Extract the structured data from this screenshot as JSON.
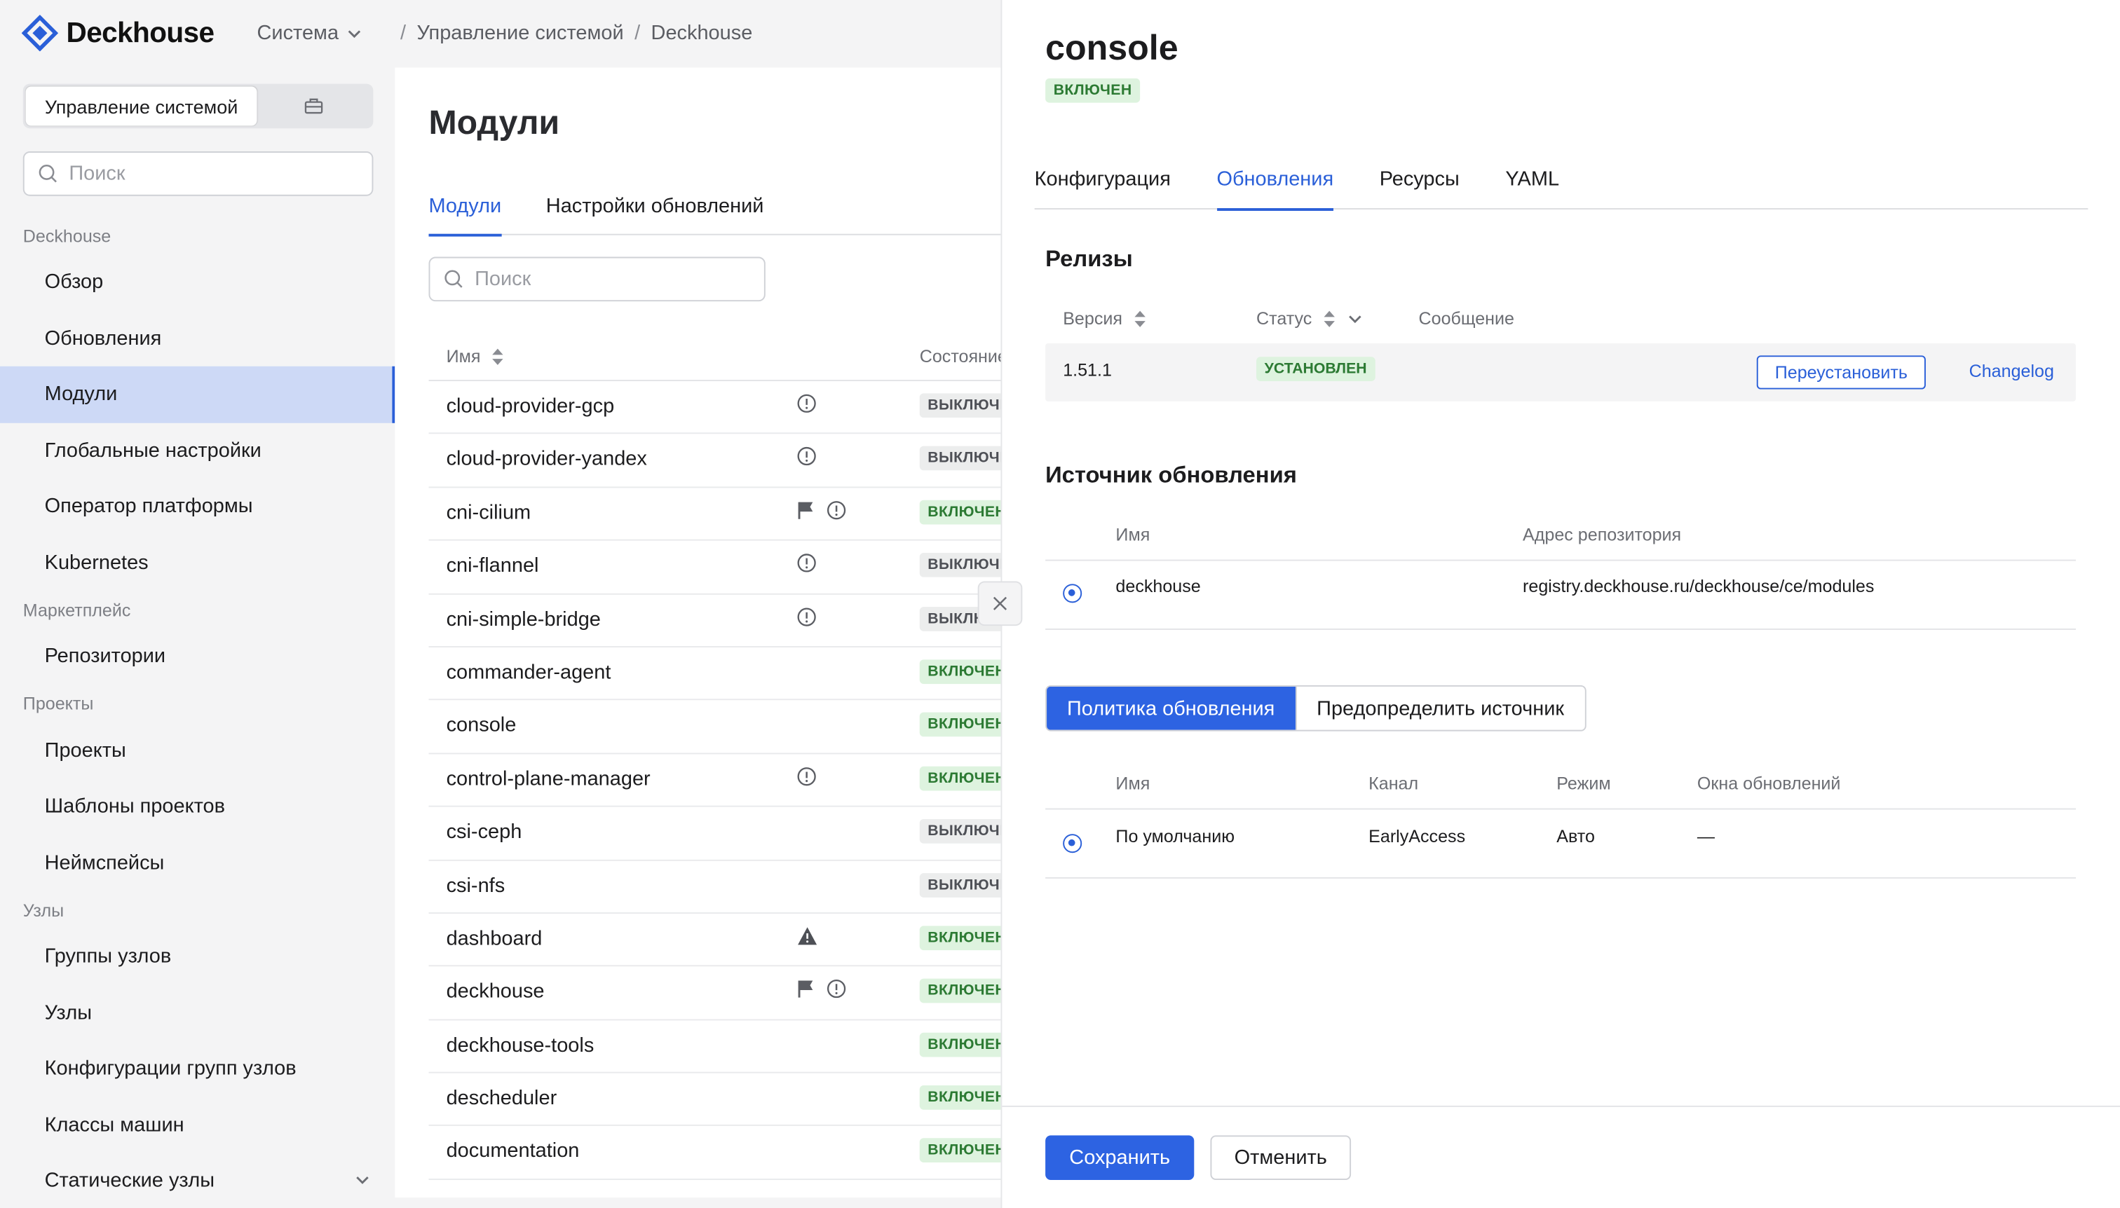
{
  "brand": {
    "name": "Deckhouse",
    "color": "#2a5fd8"
  },
  "header": {
    "system_menu": "Система",
    "breadcrumb": [
      "Управление системой",
      "Deckhouse"
    ],
    "separator": "/"
  },
  "sidebar": {
    "segment_label": "Управление системой",
    "search_placeholder": "Поиск",
    "groups": [
      {
        "label": "Deckhouse",
        "items": [
          "Обзор",
          "Обновления",
          "Модули",
          "Глобальные настройки",
          "Оператор платформы",
          "Kubernetes"
        ]
      },
      {
        "label": "Маркетплейс",
        "items": [
          "Репозитории"
        ]
      },
      {
        "label": "Проекты",
        "items": [
          "Проекты",
          "Шаблоны проектов",
          "Неймспейсы"
        ]
      },
      {
        "label": "Узлы",
        "items": [
          "Группы узлов",
          "Узлы",
          "Конфигурации групп узлов",
          "Классы машин",
          "Статические узлы"
        ]
      }
    ],
    "active_item": "Модули"
  },
  "modules": {
    "title": "Модули",
    "tabs": [
      "Модули",
      "Настройки обновлений"
    ],
    "search_placeholder": "Поиск",
    "columns": {
      "name": "Имя",
      "state": "Состояние"
    },
    "rows": [
      {
        "name": "cloud-provider-gcp",
        "icons": [
          "info-icon"
        ],
        "state": "ВЫКЛЮЧЕН",
        "on": false
      },
      {
        "name": "cloud-provider-yandex",
        "icons": [
          "info-icon"
        ],
        "state": "ВЫКЛЮЧЕН",
        "on": false
      },
      {
        "name": "cni-cilium",
        "icons": [
          "flag-icon",
          "info-icon"
        ],
        "state": "ВКЛЮЧЕН",
        "on": true
      },
      {
        "name": "cni-flannel",
        "icons": [
          "info-icon"
        ],
        "state": "ВЫКЛЮЧЕН",
        "on": false
      },
      {
        "name": "cni-simple-bridge",
        "icons": [
          "info-icon"
        ],
        "state": "ВЫКЛЮЧЕН",
        "on": false
      },
      {
        "name": "commander-agent",
        "icons": [],
        "state": "ВКЛЮЧЕН",
        "on": true
      },
      {
        "name": "console",
        "icons": [],
        "state": "ВКЛЮЧЕН",
        "on": true
      },
      {
        "name": "control-plane-manager",
        "icons": [
          "info-icon"
        ],
        "state": "ВКЛЮЧЕН",
        "on": true
      },
      {
        "name": "csi-ceph",
        "icons": [],
        "state": "ВЫКЛЮЧЕН",
        "on": false
      },
      {
        "name": "csi-nfs",
        "icons": [],
        "state": "ВЫКЛЮЧЕН",
        "on": false
      },
      {
        "name": "dashboard",
        "icons": [
          "warning-icon"
        ],
        "state": "ВКЛЮЧЕН",
        "on": true
      },
      {
        "name": "deckhouse",
        "icons": [
          "flag-icon",
          "info-icon"
        ],
        "state": "ВКЛЮЧЕН",
        "on": true
      },
      {
        "name": "deckhouse-tools",
        "icons": [],
        "state": "ВКЛЮЧЕН",
        "on": true
      },
      {
        "name": "descheduler",
        "icons": [],
        "state": "ВКЛЮЧЕН",
        "on": true
      },
      {
        "name": "documentation",
        "icons": [],
        "state": "ВКЛЮЧЕН",
        "on": true
      }
    ]
  },
  "panel": {
    "title": "console",
    "state": "ВКЛЮЧЕН",
    "tabs": [
      "Конфигурация",
      "Обновления",
      "Ресурсы",
      "YAML"
    ],
    "active_tab": "Обновления",
    "releases": {
      "title": "Релизы",
      "columns": {
        "version": "Версия",
        "status": "Статус",
        "message": "Сообщение"
      },
      "row": {
        "version": "1.51.1",
        "status": "УСТАНОВЛЕН",
        "reinstall": "Переустановить",
        "changelog": "Changelog"
      }
    },
    "source": {
      "title": "Источник обновления",
      "columns": {
        "name": "Имя",
        "repo": "Адрес репозитория"
      },
      "row": {
        "name": "deckhouse",
        "repo": "registry.deckhouse.ru/deckhouse/ce/modules"
      }
    },
    "policy": {
      "tabs": [
        "Политика обновления",
        "Предопределить источник"
      ],
      "columns": {
        "name": "Имя",
        "channel": "Канал",
        "mode": "Режим",
        "windows": "Окна обновлений"
      },
      "row": {
        "name": "По умолчанию",
        "channel": "EarlyAccess",
        "mode": "Авто",
        "windows": "—"
      }
    },
    "save": "Сохранить",
    "cancel": "Отменить"
  }
}
